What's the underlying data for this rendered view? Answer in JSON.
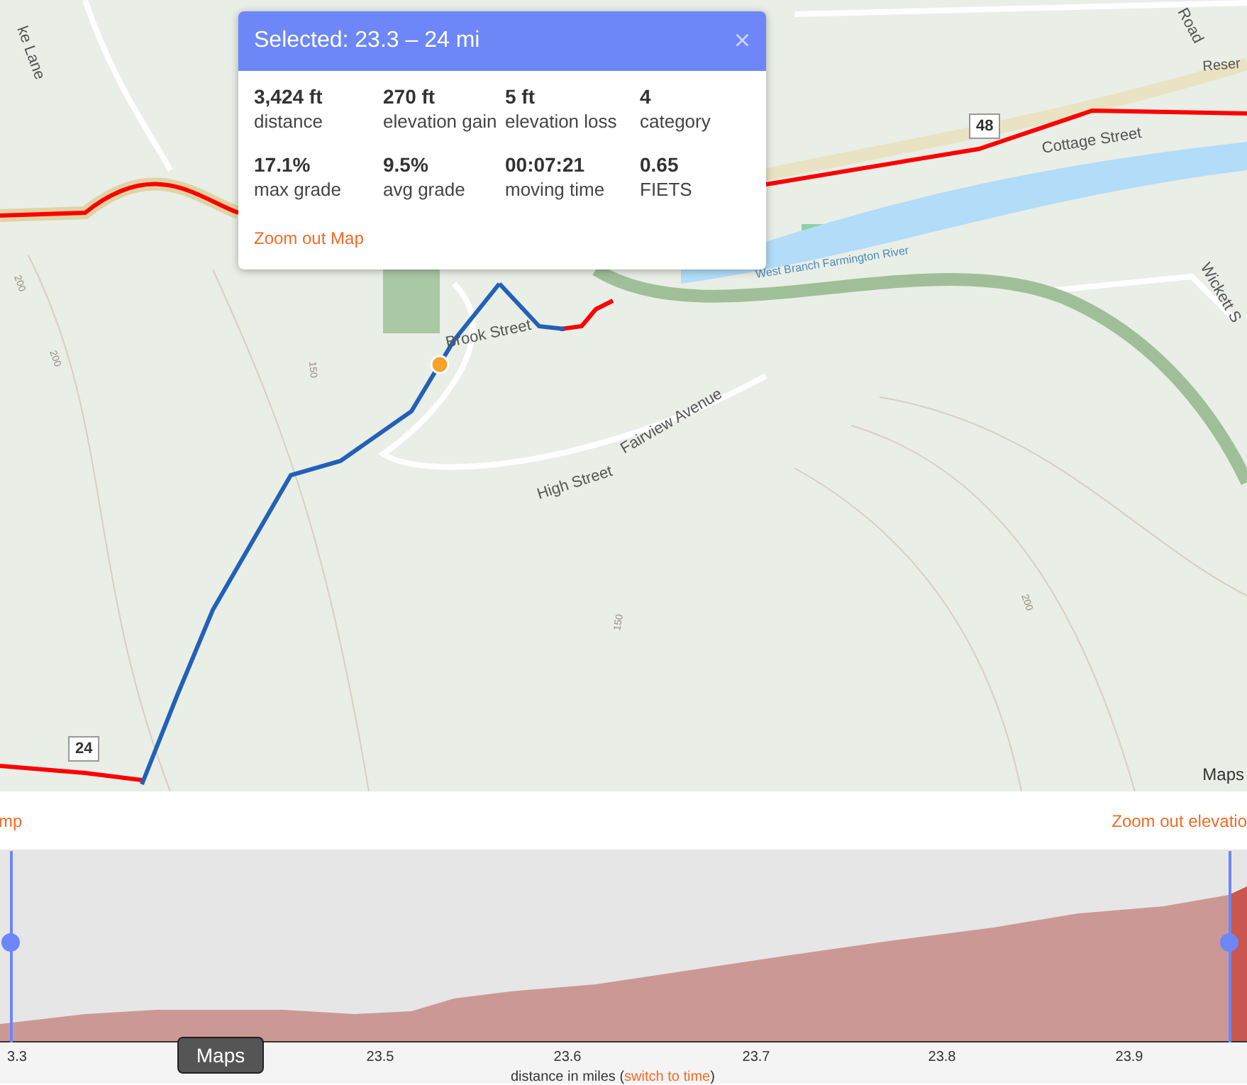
{
  "map": {
    "labels": [
      "ke Lane",
      "Brook Street",
      "High Street",
      "Fairview Avenue",
      "Cottage Street",
      "West Branch Farmington River",
      "Wickett S",
      "Road",
      "Reser",
      "200",
      "150",
      "150",
      "200",
      "200"
    ],
    "markers": [
      "24",
      "48"
    ],
    "attribution": "Maps"
  },
  "popup": {
    "title": "Selected: 23.3 – 24 mi",
    "close": "×",
    "stats": [
      {
        "value": "3,424 ft",
        "label": "distance"
      },
      {
        "value": "270 ft",
        "label": "elevation gain"
      },
      {
        "value": "5 ft",
        "label": "elevation loss"
      },
      {
        "value": "4",
        "label": "category"
      },
      {
        "value": "17.1%",
        "label": "max grade"
      },
      {
        "value": "9.5%",
        "label": "avg grade"
      },
      {
        "value": "00:07:21",
        "label": "moving time"
      },
      {
        "value": "0.65",
        "label": "FIETS"
      }
    ],
    "link": "Zoom out Map"
  },
  "elevation": {
    "left_link": "mp",
    "right_link": "Zoom out elevatio",
    "x_ticks": [
      "3.3",
      "23.5",
      "23.6",
      "23.7",
      "23.8",
      "23.9"
    ],
    "axis_label": "distance in miles (",
    "switch_link": "switch to time",
    "axis_label_end": ")",
    "tooltip": "Maps"
  }
}
